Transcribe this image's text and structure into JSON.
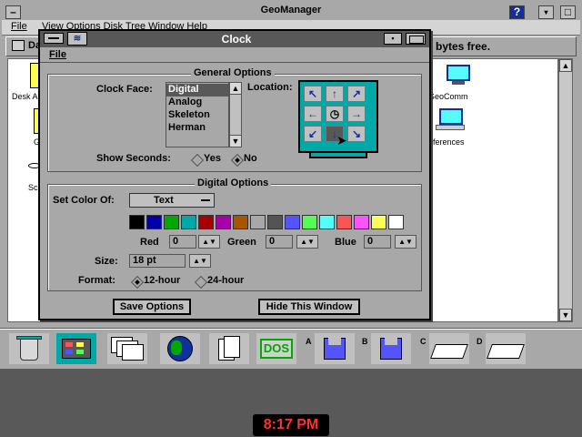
{
  "geomanager": {
    "title": "GeoManager",
    "help_label": "?",
    "menu": {
      "file": "File",
      "rest": "View  Options  Disk  Tree  Window  Help"
    },
    "drive_label": "Da",
    "free_text": "bytes free.",
    "items": [
      {
        "label": "Desk A",
        "icon": "folder-icon"
      },
      {
        "label": "G",
        "icon": "folder-icon"
      },
      {
        "label": "Sc",
        "icon": "app-icon"
      },
      {
        "label": "GeoComm",
        "icon": "computer-icon"
      },
      {
        "label": "eferences",
        "icon": "computer-icon"
      }
    ]
  },
  "clock_window": {
    "title": "Clock",
    "menu_file": "File",
    "general": {
      "title": "General Options",
      "clock_face_label": "Clock Face:",
      "faces": [
        "Digital",
        "Analog",
        "Skeleton",
        "Herman"
      ],
      "selected_face": "Digital",
      "location_label": "Location:",
      "show_seconds_label": "Show Seconds:",
      "yes": "Yes",
      "no": "No",
      "show_seconds": "No"
    },
    "digital": {
      "title": "Digital Options",
      "set_color_label": "Set Color Of:",
      "set_color_value": "Text",
      "palette": [
        "#000000",
        "#0000a8",
        "#00a800",
        "#00a8a8",
        "#a80000",
        "#a800a8",
        "#a85400",
        "#a8a8a8",
        "#545454",
        "#5454fc",
        "#54fc54",
        "#54fcfc",
        "#fc5454",
        "#fc54fc",
        "#fcfc54",
        "#ffffff"
      ],
      "red_label": "Red",
      "red_value": "0",
      "green_label": "Green",
      "green_value": "0",
      "blue_label": "Blue",
      "blue_value": "0",
      "size_label": "Size:",
      "size_value": "18 pt",
      "format_label": "Format:",
      "format_12": "12-hour",
      "format_24": "24-hour",
      "format_selected": "12-hour"
    },
    "buttons": {
      "save": "Save Options",
      "hide": "Hide This Window"
    }
  },
  "taskbar": {
    "dos_label": "DOS",
    "drive_a": "A",
    "drive_b": "B",
    "drive_c": "C",
    "drive_d": "D"
  },
  "clock_display": "8:17 PM"
}
